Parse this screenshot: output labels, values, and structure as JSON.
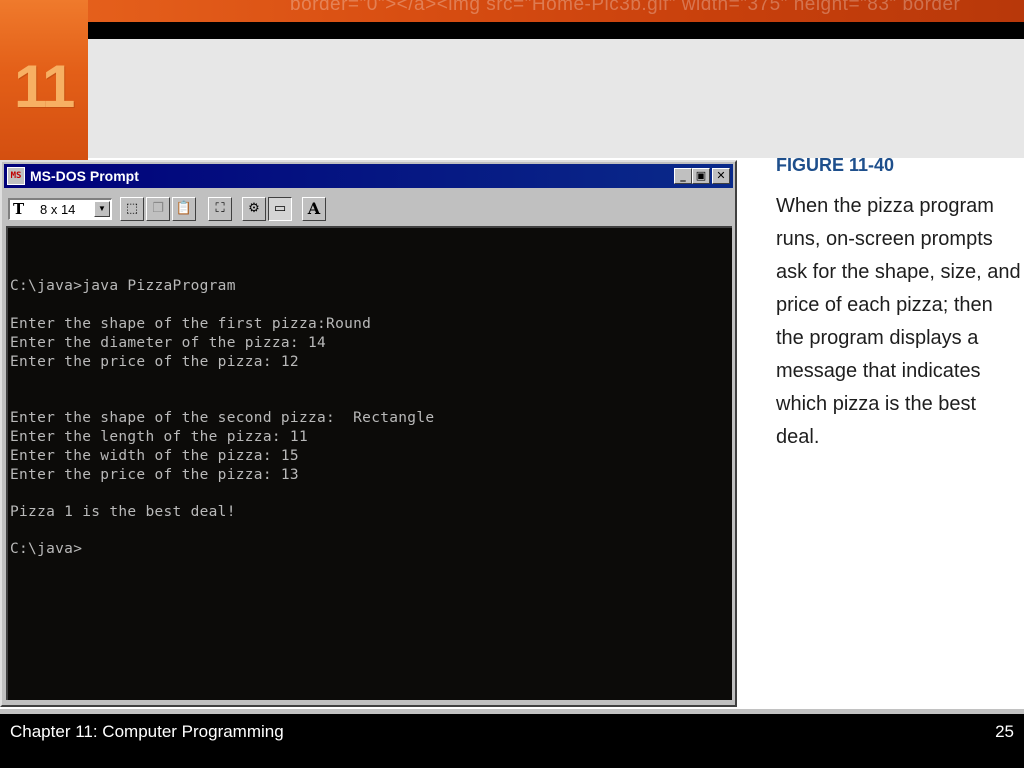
{
  "slide": {
    "header_code_text": "border=\"0\"></a><img src=\"Home-Pic3b.gif\" width=\"375\" height=\"83\" border",
    "chapter_number": "11"
  },
  "window": {
    "title": "MS-DOS Prompt",
    "icon_text": "MS",
    "controls": {
      "minimize": "_",
      "maximize": "▣",
      "close": "✕"
    },
    "toolbar": {
      "font_size": "8 x 14",
      "font_icon": "T",
      "buttons": [
        {
          "name": "mark-icon",
          "glyph": "⬚"
        },
        {
          "name": "copy-icon",
          "glyph": "❐"
        },
        {
          "name": "paste-icon",
          "glyph": "📋"
        },
        {
          "name": "fullscreen-icon",
          "glyph": "⛶"
        },
        {
          "name": "properties-icon",
          "glyph": "⚙"
        },
        {
          "name": "background-icon",
          "glyph": "▭"
        },
        {
          "name": "font-icon",
          "glyph": "A"
        }
      ]
    }
  },
  "console": {
    "lines": [
      "C:\\java>java PizzaProgram",
      "Enter the shape of the first pizza:Round",
      "Enter the diameter of the pizza: 14",
      "Enter the price of the pizza: 12",
      "Enter the shape of the second pizza:  Rectangle",
      "Enter the length of the pizza: 11",
      "Enter the width of the pizza: 15",
      "Enter the price of the pizza: 13",
      "Pizza 1 is the best deal!",
      "C:\\java>"
    ]
  },
  "caption": {
    "figure_label": "FIGURE 11-40",
    "lines": [
      "When the pizza program",
      "runs, on-screen prompts",
      "ask for the shape, size, and",
      "price of each pizza; then",
      "the program displays a",
      "message that indicates",
      "which pizza is the best",
      "deal."
    ]
  },
  "footer": {
    "chapter_text": "Chapter 11: Computer Programming",
    "page_number": "25"
  },
  "colors": {
    "accent_orange": "#e35f18",
    "caption_blue": "#1e4f8c",
    "titlebar_navy": "#00007a",
    "console_text": "#b9b9b9"
  }
}
